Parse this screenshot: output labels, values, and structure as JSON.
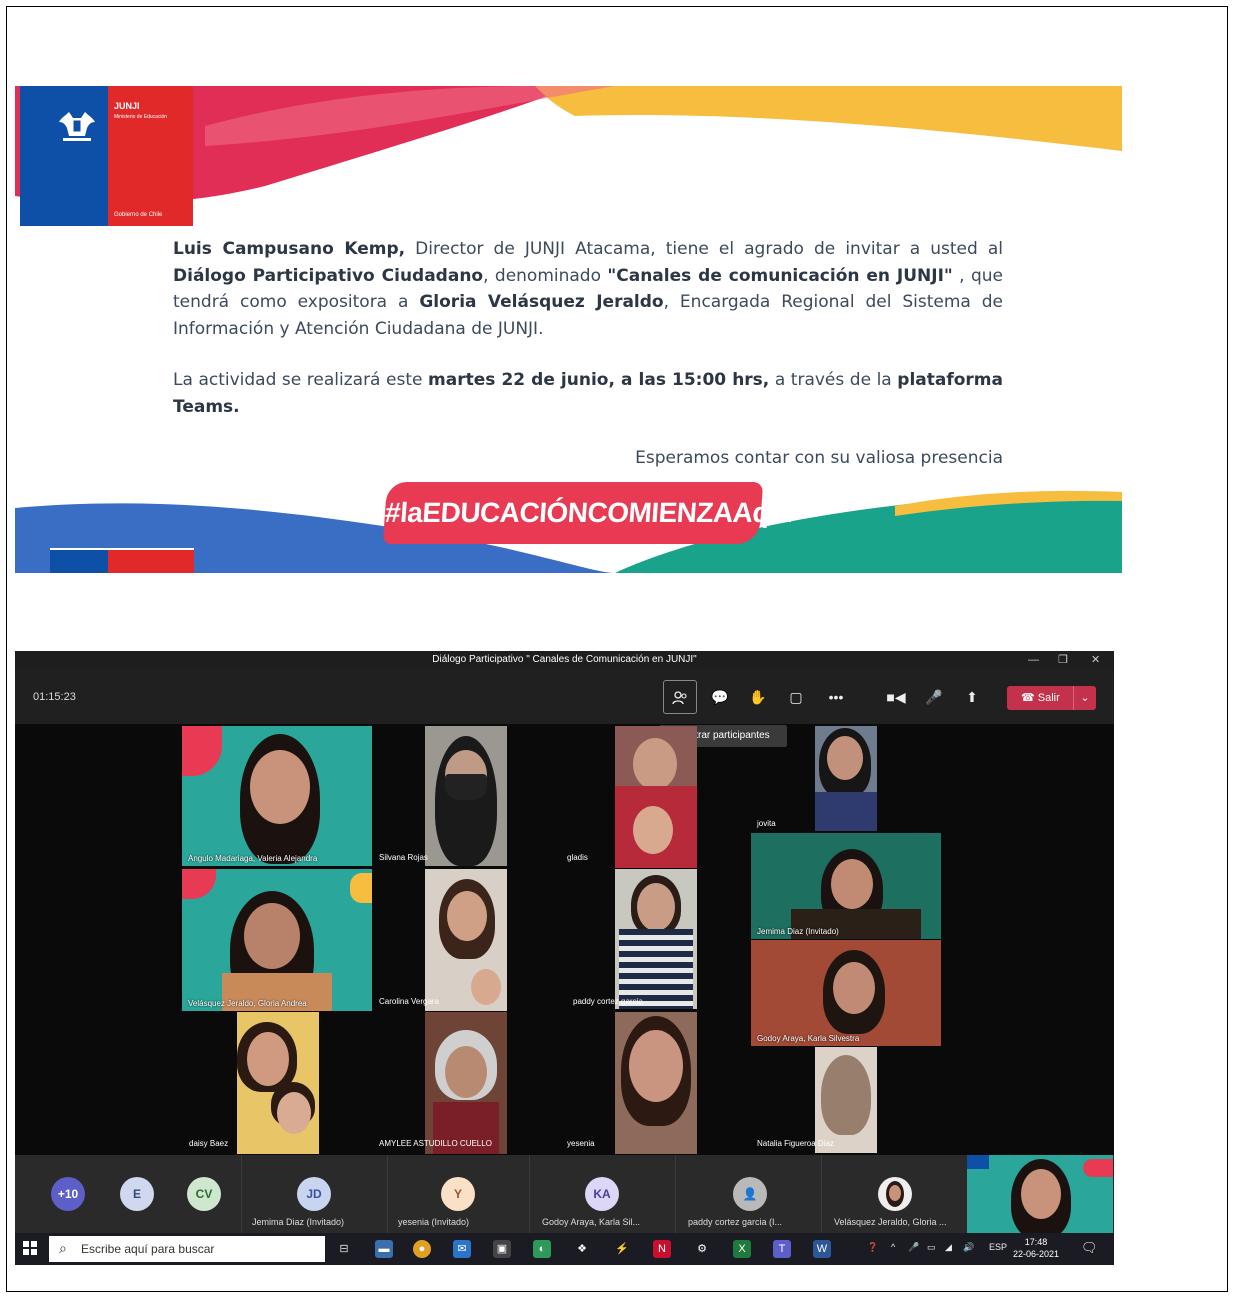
{
  "invitation": {
    "logo": {
      "org": "JUNJI",
      "ministry": "Ministerio de Educación",
      "government": "Gobierno de Chile"
    },
    "p1": {
      "director": "Luis Campusano Kemp,",
      "t1": " Director de JUNJI Atacama, tiene el agrado de invitar a usted al ",
      "event": "Diálogo Participativo Ciudadano",
      "t2": ", denominado ",
      "title": "\"Canales de comunicación en JUNJI\"",
      "t3": " , que tendrá como expositora a ",
      "speaker": "Gloria Velásquez Jeraldo",
      "t4": ", Encargada Regional del Sistema de Información y Atención Ciudadana de JUNJI."
    },
    "p2": {
      "t1": "La actividad se realizará este ",
      "date": "martes 22 de junio, a las 15:00 hrs,",
      "t2": "  a través de la ",
      "platform": "plataforma Teams."
    },
    "closing": "Esperamos contar con su valiosa presencia",
    "hashtag": "#laEDUCACIÓNCOMIENZAAquí",
    "colors": {
      "red": "#e02928",
      "blue": "#0e4fa8",
      "pink": "#e83a53",
      "yellow": "#f7bd3f",
      "green": "#19a38a"
    }
  },
  "teams": {
    "window_title": "Diálogo Participativo \" Canales de Comunicación en JUNJI\"",
    "timer": "01:15:23",
    "tooltip": "Mostrar participantes",
    "leave_label": "Salir",
    "toolbar_icons": [
      "participants-icon",
      "chat-icon",
      "reactions-icon",
      "rooms-icon",
      "more-icon",
      "camera-icon",
      "mic-icon",
      "share-icon"
    ],
    "tiles": [
      {
        "name": "Angulo Madariaga, Valeria Alejandra"
      },
      {
        "name": "Silvana Rojas"
      },
      {
        "name": "gladis"
      },
      {
        "name": "jovita"
      },
      {
        "name": "Jemima Diaz (Invitado)"
      },
      {
        "name": "Velásquez Jeraldo, Gloria Andrea"
      },
      {
        "name": "Carolina Vergara"
      },
      {
        "name": "paddy cortez garcia"
      },
      {
        "name": "Godoy Araya, Karla Silvestra"
      },
      {
        "name": "daisy Baez"
      },
      {
        "name": "AMYLEE ASTUDILLO CUELLO"
      },
      {
        "name": "yesenia"
      },
      {
        "name": "Natalia Figueroa Diaz"
      }
    ],
    "roster": [
      {
        "initials": "+10",
        "name": ""
      },
      {
        "initials": "E",
        "name": ""
      },
      {
        "initials": "CV",
        "name": ""
      },
      {
        "initials": "JD",
        "name": "Jemima Diaz (Invitado)"
      },
      {
        "initials": "Y",
        "name": "yesenia (Invitado)"
      },
      {
        "initials": "KA",
        "name": "Godoy Araya, Karla Sil..."
      },
      {
        "initials": "",
        "name": "paddy cortez garcia (I..."
      },
      {
        "initials": "",
        "name": "Velásquez Jeraldo, Gloria ..."
      }
    ],
    "taskbar": {
      "search_placeholder": "Escribe aquí para buscar",
      "lang": "ESP",
      "time": "17:48",
      "date": "22-06-2021"
    }
  }
}
